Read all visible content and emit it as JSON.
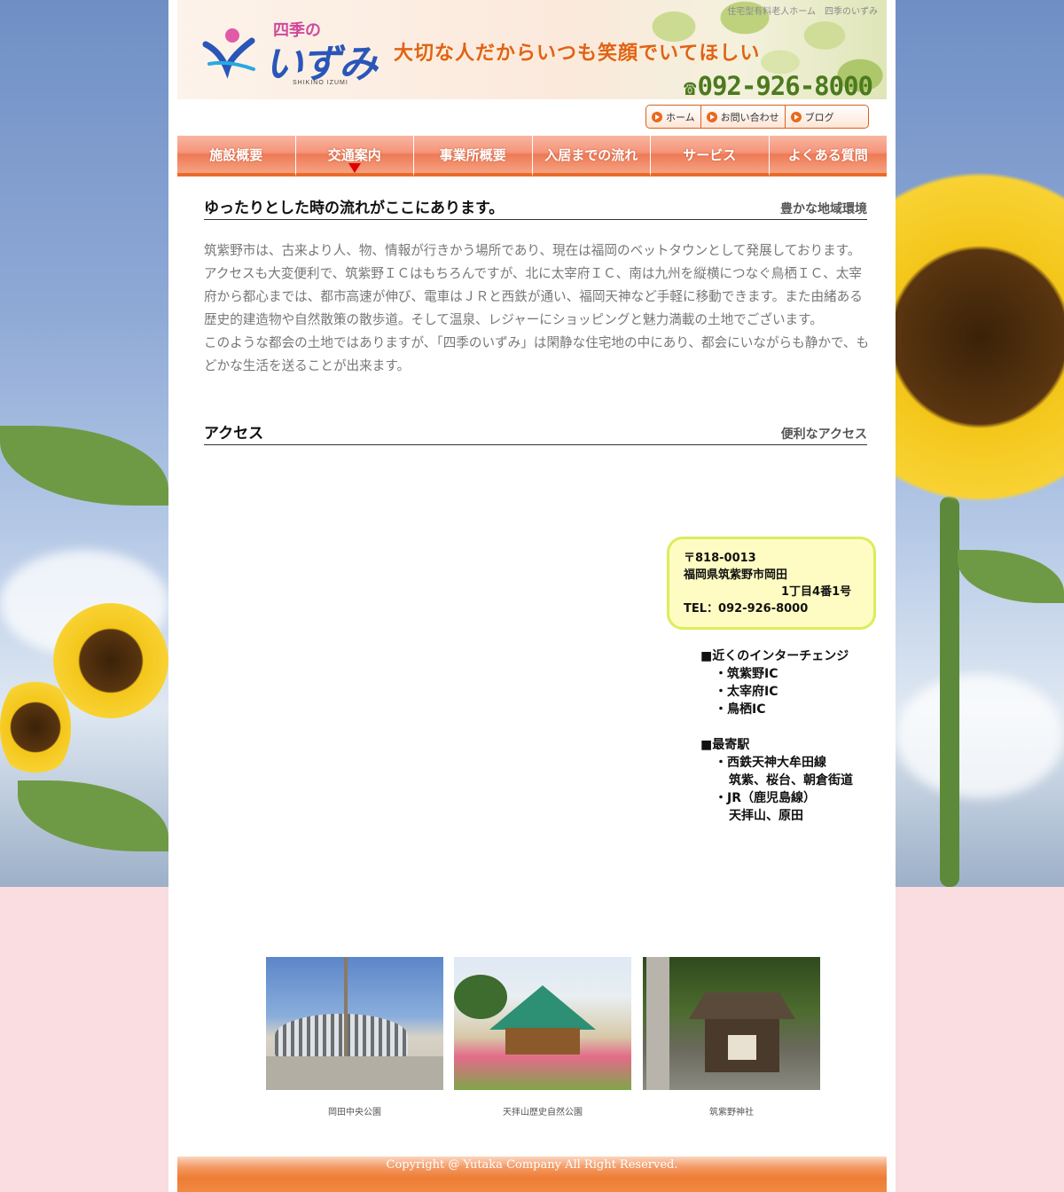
{
  "header": {
    "breadcrumb": "住宅型有料老人ホーム　四季のいずみ",
    "logo_small": "四季の",
    "logo_main": "いずみ",
    "logo_sub": "SHIKINO IZUMI",
    "tagline": "大切な人だからいつも笑顔でいてほしい",
    "phone": "092-926-8000"
  },
  "utility_links": [
    {
      "label": "ホーム",
      "icon": "play-circle-icon"
    },
    {
      "label": "お問い合わせ",
      "icon": "play-circle-icon"
    },
    {
      "label": "ブログ",
      "icon": "play-circle-icon"
    }
  ],
  "nav": {
    "items": [
      {
        "label": "施設概要"
      },
      {
        "label": "交通案内",
        "active": true
      },
      {
        "label": "事業所概要"
      },
      {
        "label": "入居までの流れ"
      },
      {
        "label": "サービス"
      },
      {
        "label": "よくある質問"
      }
    ]
  },
  "section1": {
    "title": "ゆったりとした時の流れがここにあります。",
    "subtitle": "豊かな地域環境",
    "paragraph1": "筑紫野市は、古来より人、物、情報が行きかう場所であり、現在は福岡のベットタウンとして発展しております。アクセスも大変便利で、筑紫野ＩＣはもちろんですが、北に太宰府ＩＣ、南は九州を縦横につなぐ鳥栖ＩＣ、太宰府から都心までは、都市高速が伸び、電車はＪＲと西鉄が通い、福岡天神など手軽に移動できます。また由緒ある歴史的建造物や自然散策の散歩道。そして温泉、レジャーにショッピングと魅力満載の土地でございます。",
    "paragraph2": "このような都会の土地ではありますが、「四季のいずみ」は閑静な住宅地の中にあり、都会にいながらも静かで、もどかな生活を送ることが出来ます。"
  },
  "section2": {
    "title": "アクセス",
    "subtitle": "便利なアクセス"
  },
  "address": {
    "postal": "〒818-0013",
    "line1": "福岡県筑紫野市岡田",
    "line2": "1丁目4番1号",
    "tel": "TEL：092-926-8000"
  },
  "access": {
    "ic_heading": "■近くのインターチェンジ",
    "ic_items": [
      "・筑紫野IC",
      "・太宰府IC",
      "・鳥栖IC"
    ],
    "station_heading": "■最寄駅",
    "line1": "・西鉄天神大牟田線",
    "line1_stations": "筑紫、桜台、朝倉街道",
    "line2": "・JR（鹿児島線）",
    "line2_stations": "天拝山、原田"
  },
  "photos": [
    {
      "caption": "岡田中央公園"
    },
    {
      "caption": "天拝山歴史自然公園"
    },
    {
      "caption": "筑紫野神社"
    }
  ],
  "footer": {
    "copyright": "Copyright @ Yutaka Company  All Right Reserved."
  },
  "colors": {
    "accent_orange": "#e96b2b",
    "nav_pink": "#f59479",
    "address_bg": "#fefcc2",
    "address_border": "#d9ee5a",
    "phone_green": "#4c7a1e"
  }
}
